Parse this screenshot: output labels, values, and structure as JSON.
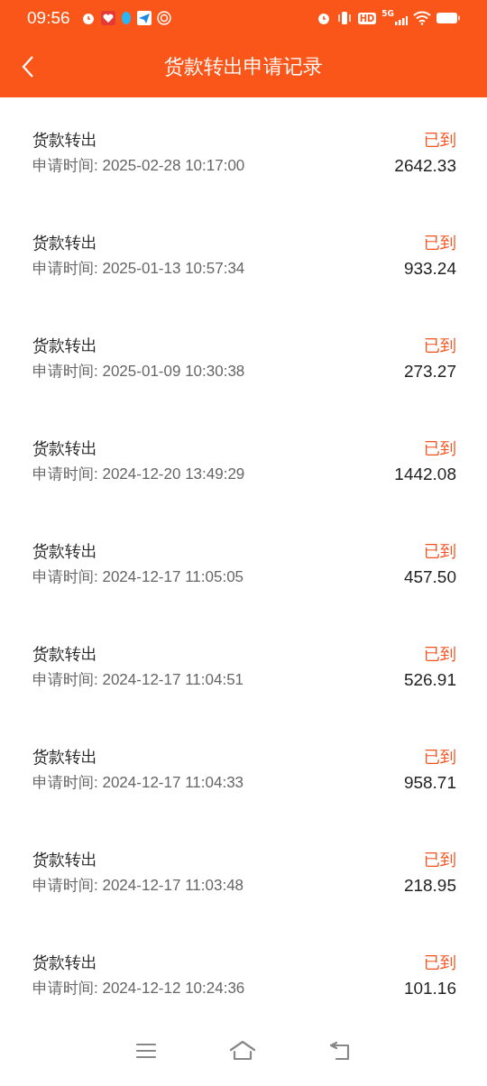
{
  "status_bar": {
    "time": "09:56",
    "hd": "HD",
    "network": "5G"
  },
  "nav": {
    "title": "货款转出申请记录"
  },
  "records": [
    {
      "title": "货款转出",
      "time": "申请时间: 2025-02-28 10:17:00",
      "status": "已到",
      "amount": "2642.33"
    },
    {
      "title": "货款转出",
      "time": "申请时间: 2025-01-13 10:57:34",
      "status": "已到",
      "amount": "933.24"
    },
    {
      "title": "货款转出",
      "time": "申请时间: 2025-01-09 10:30:38",
      "status": "已到",
      "amount": "273.27"
    },
    {
      "title": "货款转出",
      "time": "申请时间: 2024-12-20 13:49:29",
      "status": "已到",
      "amount": "1442.08"
    },
    {
      "title": "货款转出",
      "time": "申请时间: 2024-12-17 11:05:05",
      "status": "已到",
      "amount": "457.50"
    },
    {
      "title": "货款转出",
      "time": "申请时间: 2024-12-17 11:04:51",
      "status": "已到",
      "amount": "526.91"
    },
    {
      "title": "货款转出",
      "time": "申请时间: 2024-12-17 11:04:33",
      "status": "已到",
      "amount": "958.71"
    },
    {
      "title": "货款转出",
      "time": "申请时间: 2024-12-17 11:03:48",
      "status": "已到",
      "amount": "218.95"
    },
    {
      "title": "货款转出",
      "time": "申请时间: 2024-12-12 10:24:36",
      "status": "已到",
      "amount": "101.16"
    }
  ]
}
